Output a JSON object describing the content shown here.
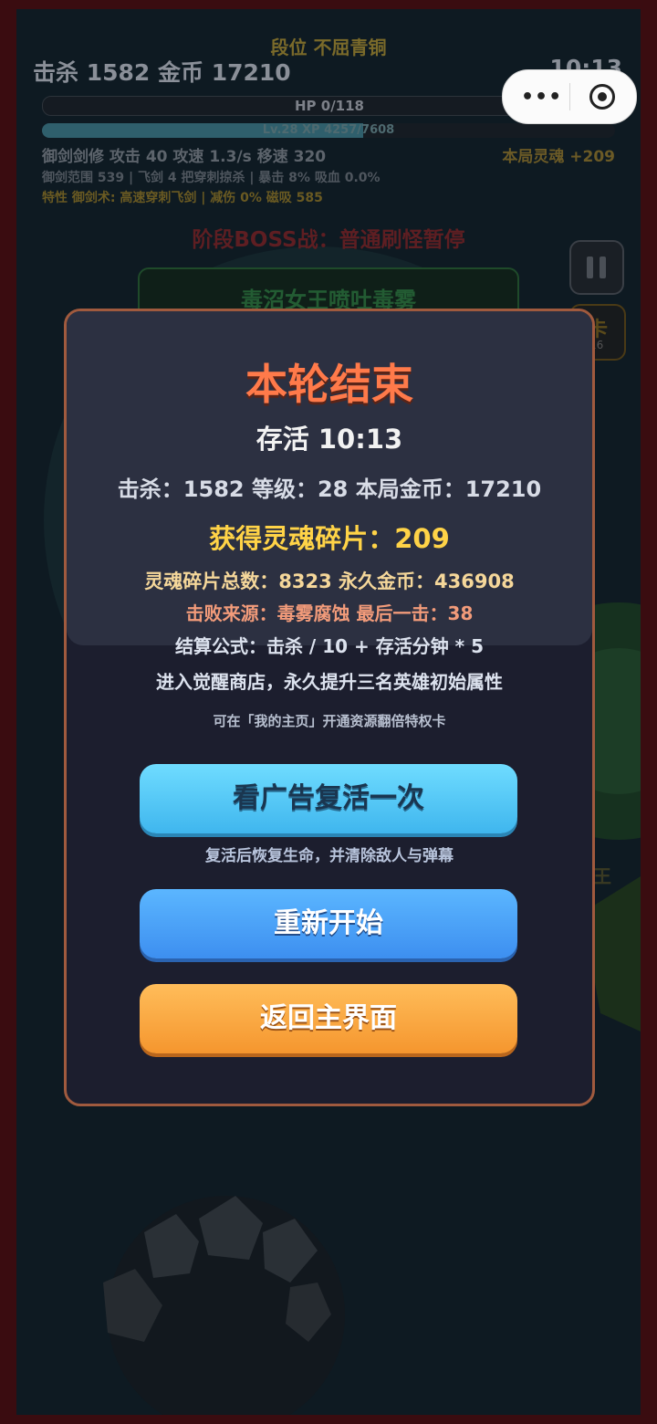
{
  "hud": {
    "rank": "段位 不屈青铜",
    "kills_gold": "击杀 1582  金币 17210",
    "clock": "10:13",
    "hp": "HP 0/118",
    "xp": "Lv.28  XP 4257/7608",
    "xp_fraction": 0.56,
    "stats_line1": "御剑剑修  攻击 40  攻速 1.3/s  移速 320",
    "soul_gain": "本局灵魂 +209",
    "stats_line2": "御剑范围 539 | 飞剑 4 把穿刺掠杀 | 暴击 8% 吸血 0.0%",
    "stats_line3": "特性 御剑术: 高速穿刺飞剑 | 减伤 0% 磁吸 585",
    "boss_warning": "阶段BOSS战：普通刷怪暂停",
    "boss_name": "毒沼女王喷吐毒雾",
    "side_glyph": "卡",
    "side_num": "16",
    "boss_side_glyph": "王"
  },
  "capsule": {
    "dots": "•••"
  },
  "modal": {
    "title": "本轮结束",
    "survive": "存活 10:13",
    "stats": "击杀：1582   等级：28   本局金币：17210",
    "soul_shards": "获得灵魂碎片：209",
    "totals": "灵魂碎片总数：8323   永久金币：436908",
    "defeat": "击败来源：毒雾腐蚀  最后一击：38",
    "formula": "结算公式：击杀 / 10 + 存活分钟 * 5",
    "awaken": "进入觉醒商店，永久提升三名英雄初始属性",
    "privilege": "可在「我的主页」开通资源翻倍特权卡",
    "revive_button": "看广告复活一次",
    "revive_hint": "复活后恢复生命，并清除敌人与弹幕",
    "restart_button": "重新开始",
    "home_button": "返回主界面"
  }
}
